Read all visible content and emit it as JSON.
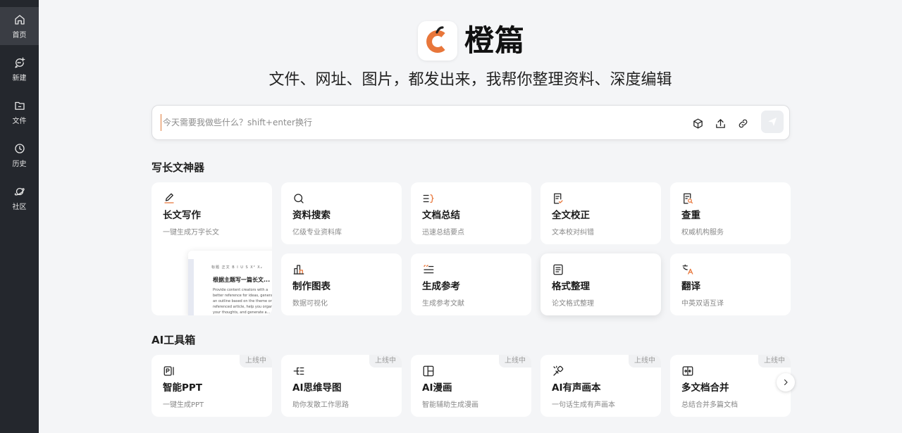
{
  "sidebar": {
    "items": [
      {
        "label": "首页",
        "icon": "home-icon",
        "active": true
      },
      {
        "label": "新建",
        "icon": "new-chat-icon",
        "active": false
      },
      {
        "label": "文件",
        "icon": "folder-icon",
        "active": false
      },
      {
        "label": "历史",
        "icon": "clock-icon",
        "active": false
      },
      {
        "label": "社区",
        "icon": "planet-icon",
        "active": false
      }
    ]
  },
  "brand": {
    "name": "橙篇",
    "logo_letter": "C",
    "accent": "#e8763a",
    "tagline": "文件、网址、图片，都发出来，我帮你整理资料、深度编辑"
  },
  "chat": {
    "placeholder": "今天需要我做些什么？shift+enter换行",
    "value": "",
    "tools": [
      "cube-icon",
      "upload-icon",
      "link-icon"
    ],
    "send_icon": "send-icon"
  },
  "writing": {
    "title": "写长文神器",
    "featured": {
      "title": "长文写作",
      "desc": "一键生成万字长文",
      "icon": "pen-icon",
      "preview": {
        "toolbar": "B I U S X² X₂",
        "toolbar_prefix": "标题 正文",
        "doc_title": "根据主题写一篇长文...",
        "doc_body": "Provide content creators with a better reference for ideas, generate an outline based on the theme or referenced article, help you organize your thoughts, and generate a..."
      }
    },
    "cards": [
      {
        "title": "资料搜索",
        "desc": "亿级专业资料库",
        "icon": "search-icon"
      },
      {
        "title": "文档总结",
        "desc": "迅速总结要点",
        "icon": "summary-icon"
      },
      {
        "title": "全文校正",
        "desc": "文本校对纠错",
        "icon": "proofread-icon"
      },
      {
        "title": "查重",
        "desc": "权威机构服务",
        "icon": "plagiarism-check-icon"
      },
      {
        "title": "制作图表",
        "desc": "数据可视化",
        "icon": "chart-icon"
      },
      {
        "title": "生成参考",
        "desc": "生成参考文献",
        "icon": "quote-icon"
      },
      {
        "title": "格式整理",
        "desc": "论文格式整理",
        "icon": "format-icon"
      },
      {
        "title": "翻译",
        "desc": "中英双语互译",
        "icon": "translate-icon"
      }
    ]
  },
  "toolbox": {
    "title": "AI工具箱",
    "badge": "上线中",
    "cards": [
      {
        "title": "智能PPT",
        "desc": "一键生成PPT",
        "icon": "ppt-icon"
      },
      {
        "title": "AI思维导图",
        "desc": "助你发散工作思路",
        "icon": "mindmap-icon"
      },
      {
        "title": "AI漫画",
        "desc": "智能辅助生成漫画",
        "icon": "comic-icon"
      },
      {
        "title": "AI有声画本",
        "desc": "一句话生成有声画本",
        "icon": "audiobook-icon"
      },
      {
        "title": "多文档合并",
        "desc": "总结合并多篇文档",
        "icon": "merge-docs-icon"
      }
    ]
  }
}
